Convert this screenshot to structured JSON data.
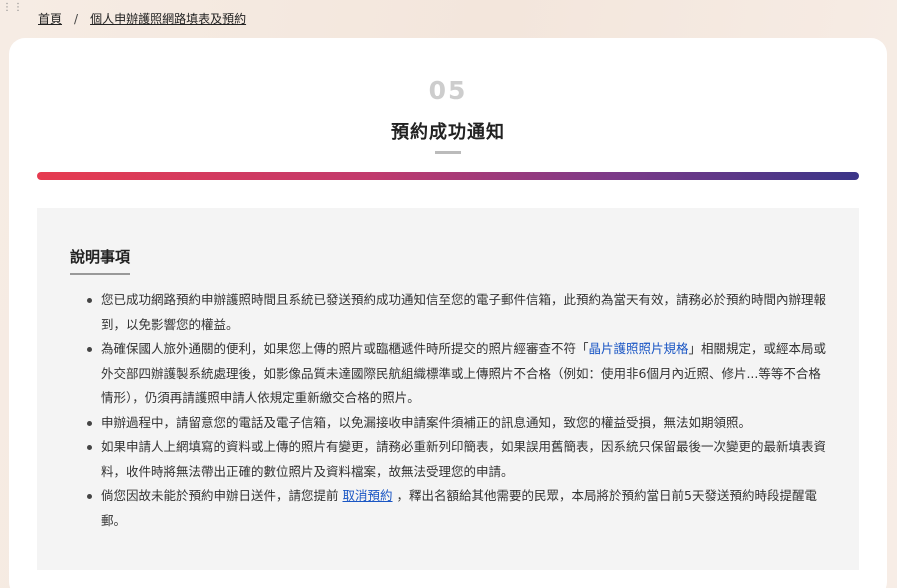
{
  "breadcrumb": {
    "home": "首頁",
    "separator": "/",
    "current": "個人申辦護照網路填表及預約"
  },
  "step": {
    "number": "05",
    "title": "預約成功通知"
  },
  "notice": {
    "heading": "說明事項",
    "item1": "您已成功網路預約申辦護照時間且系統已發送預約成功通知信至您的電子郵件信箱，此預約為當天有效，請務必於預約時間內辦理報到，以免影響您的權益。",
    "item2_before": "為確保國人旅外通關的便利，如果您上傳的照片或臨櫃遞件時所提交的照片經審查不符「",
    "item2_link": "晶片護照照片規格",
    "item2_after": "」相關規定，或經本局或外交部四辦護製系統處理後，如影像品質未達國際民航組織標準或上傳照片不合格（例如：使用非6個月內近照、修片...等等不合格情形），仍須再請護照申請人依規定重新繳交合格的照片。",
    "item3": "申辦過程中，請留意您的電話及電子信箱，以免漏接收申請案件須補正的訊息通知，致您的權益受損，無法如期領照。",
    "item4": "如果申請人上網填寫的資料或上傳的照片有變更，請務必重新列印簡表，如果誤用舊簡表，因系統只保留最後一次變更的最新填表資料，收件時將無法帶出正確的數位照片及資料檔案，故無法受理您的申請。",
    "item5_before": "倘您因故未能於預約申辦日送件，請您提前",
    "item5_link": "取消預約",
    "item5_after": "，釋出名額給其他需要的民眾，本局將於預約當日前5天發送預約時段提醒電郵。"
  },
  "colors": {
    "gradient_start": "#e63b50",
    "gradient_end": "#3a3588",
    "link": "#1a56c4"
  }
}
